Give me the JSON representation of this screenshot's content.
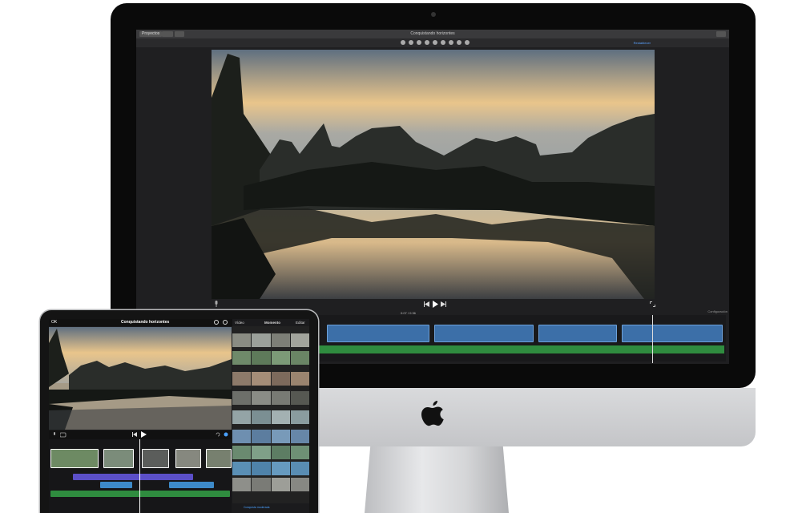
{
  "imac": {
    "window_title": "Conquistando horizontes",
    "projects_button": "Proyectos",
    "reset_label": "Restablecer",
    "timecode": "0:07 / 0:36",
    "settings_label": "Configuración"
  },
  "ipad": {
    "ok_label": "OK",
    "project_title": "Conquistando horizontes",
    "media_tabs": [
      "Vídeo",
      "Momento",
      "Editar"
    ],
    "media_footer": "Conquista moderada"
  },
  "colors": {
    "clip_blue": "#3c6fa8",
    "audio_green": "#2f8c3f",
    "audio_purple": "#5b4fc8",
    "accent": "#5aa2ff"
  },
  "icons": [
    "apple-logo-icon",
    "play-icon",
    "skip-back-icon",
    "skip-forward-icon",
    "microphone-icon",
    "fullscreen-icon",
    "help-icon",
    "settings-icon"
  ]
}
